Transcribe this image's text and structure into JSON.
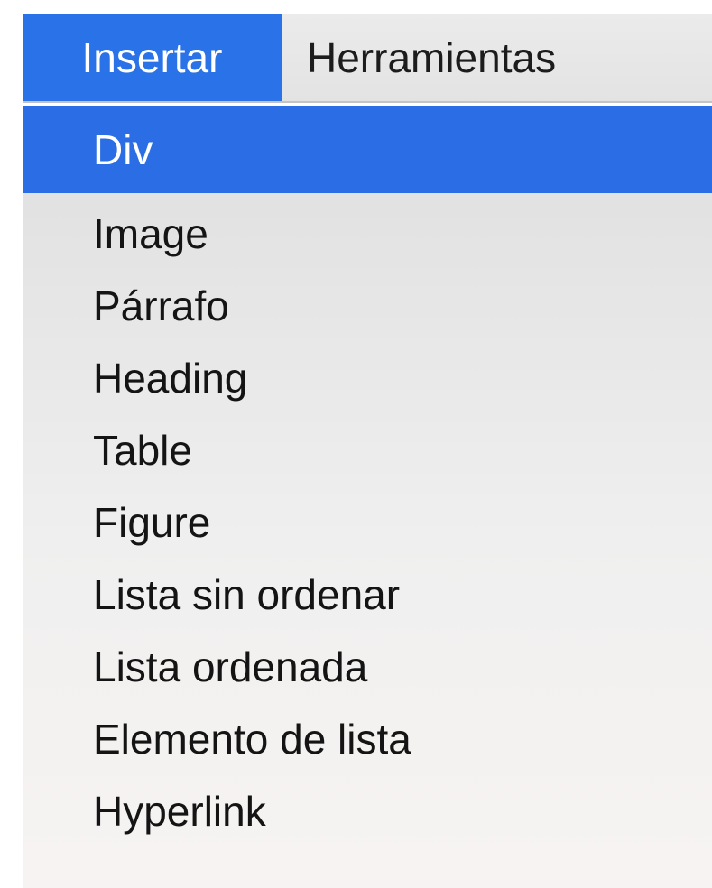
{
  "menubar": {
    "items": [
      {
        "label": "Insertar",
        "active": true
      },
      {
        "label": "Herramientas",
        "active": false
      }
    ]
  },
  "dropdown": {
    "highlight_color": "#2a6de4",
    "items": [
      {
        "label": "Div",
        "highlighted": true
      },
      {
        "label": "Image"
      },
      {
        "label": "Párrafo"
      },
      {
        "label": "Heading"
      },
      {
        "label": "Table"
      },
      {
        "label": "Figure"
      },
      {
        "label": "Lista sin ordenar"
      },
      {
        "label": "Lista ordenada"
      },
      {
        "label": "Elemento de lista"
      },
      {
        "label": "Hyperlink"
      }
    ]
  }
}
